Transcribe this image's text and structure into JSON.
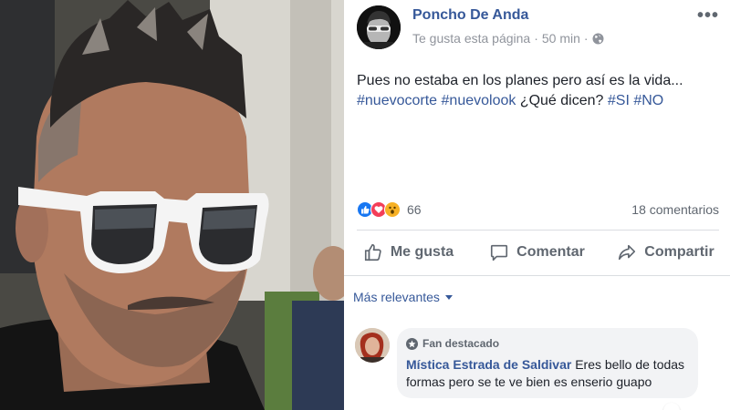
{
  "post": {
    "author": "Poncho De Anda",
    "follow_status": "Te gusta esta página",
    "separator": "·",
    "time": "50 min",
    "privacy_icon": "globe-icon",
    "more_label": "•••",
    "text_main": "Pues no estaba en los planes pero así es la vida...",
    "hashtag_1": "#nuevocorte",
    "hashtag_2": "#nuevolook",
    "text_question": "¿Qué dicen?",
    "hashtag_3": "#SI",
    "hashtag_4": "#NO"
  },
  "reactions": {
    "icons": [
      "like-icon",
      "love-icon",
      "wow-icon"
    ],
    "count": "66",
    "comments": "18 comentarios"
  },
  "actions": {
    "like": "Me gusta",
    "comment": "Comentar",
    "share": "Compartir"
  },
  "comments_sort": {
    "label": "Más relevantes"
  },
  "comment": {
    "badge": "Fan destacado",
    "author": "Mística Estrada de Saldivar",
    "text": "Eres bello de todas formas pero se te ve bien es enserio guapo"
  },
  "colors": {
    "link": "#365899",
    "muted": "#606770",
    "like": "#1877f2",
    "love": "#f33e58",
    "wow": "#f7b125"
  }
}
